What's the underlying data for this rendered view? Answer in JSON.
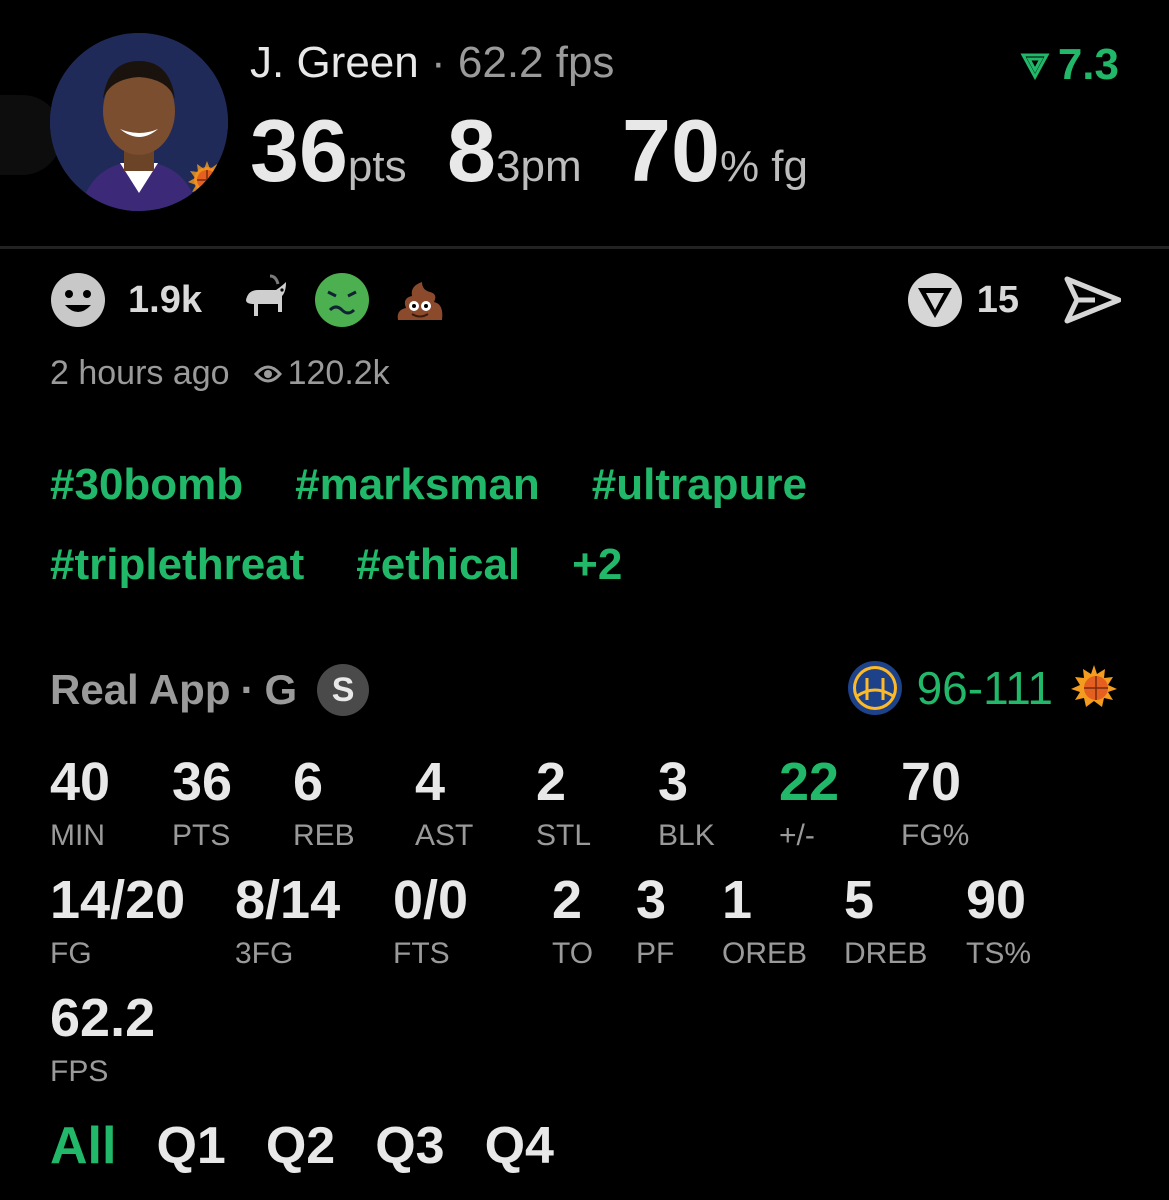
{
  "header": {
    "player_name": "J. Green",
    "separator": "·",
    "fps_label": "62.2 fps",
    "rating": "7.3",
    "big_stats": [
      {
        "value": "36",
        "unit": "pts"
      },
      {
        "value": "8",
        "unit": "3pm"
      },
      {
        "value": "70",
        "unit": "% fg"
      }
    ]
  },
  "reactions": {
    "count": "1.9k",
    "emojis": [
      "smiley-icon",
      "goat-icon",
      "sick-face-icon",
      "poop-icon"
    ],
    "share_count": "15"
  },
  "meta": {
    "time_ago": "2 hours ago",
    "views": "120.2k"
  },
  "tags": {
    "row1": [
      "#30bomb",
      "#marksman",
      "#ultrapure"
    ],
    "row2": [
      "#triplethreat",
      "#ethical",
      "+2"
    ]
  },
  "game": {
    "source": "Real App",
    "separator": "·",
    "position": "G",
    "badge": "S",
    "score": "96-111",
    "home_team_icon": "warriors-logo-icon",
    "away_team_icon": "suns-logo-icon"
  },
  "stats": {
    "row1": [
      {
        "v": "40",
        "l": "MIN"
      },
      {
        "v": "36",
        "l": "PTS"
      },
      {
        "v": "6",
        "l": "REB"
      },
      {
        "v": "4",
        "l": "AST"
      },
      {
        "v": "2",
        "l": "STL"
      },
      {
        "v": "3",
        "l": "BLK"
      },
      {
        "v": "22",
        "l": "+/-"
      },
      {
        "v": "70",
        "l": "FG%"
      }
    ],
    "row2": [
      {
        "v": "14/20",
        "l": "FG"
      },
      {
        "v": "8/14",
        "l": "3FG"
      },
      {
        "v": "0/0",
        "l": "FTS"
      },
      {
        "v": "2",
        "l": "TO"
      },
      {
        "v": "3",
        "l": "PF"
      },
      {
        "v": "1",
        "l": "OREB"
      },
      {
        "v": "5",
        "l": "DREB"
      },
      {
        "v": "90",
        "l": "TS%"
      }
    ],
    "row3": [
      {
        "v": "62.2",
        "l": "FPS"
      }
    ]
  },
  "quarters": [
    "All",
    "Q1",
    "Q2",
    "Q3",
    "Q4"
  ],
  "colors": {
    "accent": "#22b86a",
    "background": "#000000",
    "muted": "#9a9a9a"
  }
}
